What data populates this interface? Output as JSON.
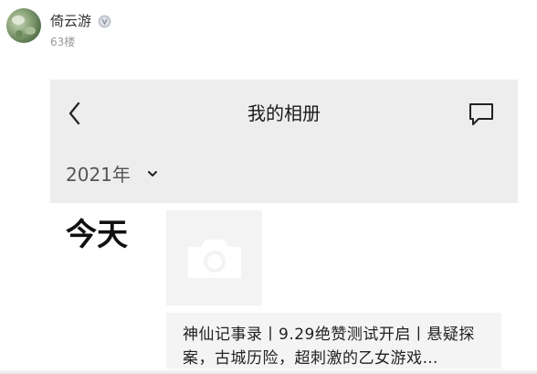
{
  "post": {
    "username": "倚云游",
    "floor": "63楼",
    "vip_icon": "vip-badge-icon"
  },
  "album": {
    "title": "我的相册",
    "back_icon": "chevron-left-icon",
    "message_icon": "comment-icon",
    "year": "2021年",
    "today": "今天",
    "photo_icon": "camera-icon",
    "card_text": "神仙记事录丨9.29绝赞测试开启丨悬疑探案，古城历险，超刺激的乙女游戏…"
  },
  "colors": {
    "topbar_bg": "#ededed",
    "card_bg": "#f4f4f4",
    "thumb_bg": "#f3f3f3"
  }
}
